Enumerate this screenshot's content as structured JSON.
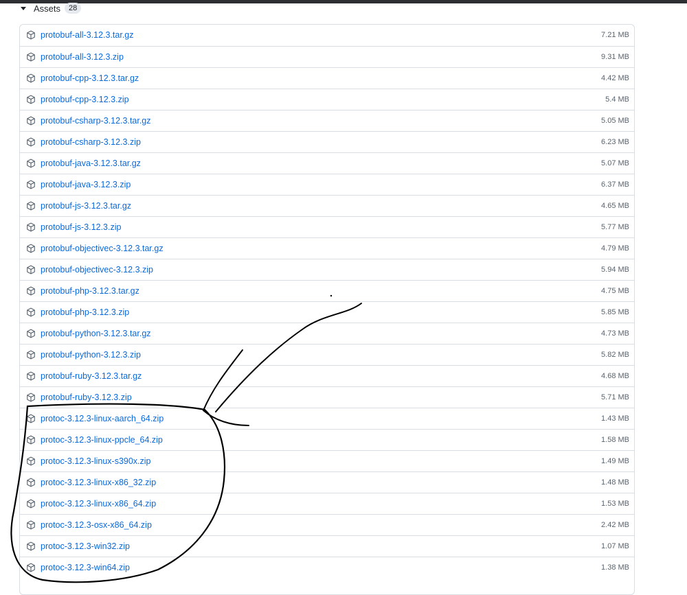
{
  "assets": {
    "title": "Assets",
    "count": "28",
    "items": [
      {
        "name": "protobuf-all-3.12.3.tar.gz",
        "size": "7.21 MB"
      },
      {
        "name": "protobuf-all-3.12.3.zip",
        "size": "9.31 MB"
      },
      {
        "name": "protobuf-cpp-3.12.3.tar.gz",
        "size": "4.42 MB"
      },
      {
        "name": "protobuf-cpp-3.12.3.zip",
        "size": "5.4 MB"
      },
      {
        "name": "protobuf-csharp-3.12.3.tar.gz",
        "size": "5.05 MB"
      },
      {
        "name": "protobuf-csharp-3.12.3.zip",
        "size": "6.23 MB"
      },
      {
        "name": "protobuf-java-3.12.3.tar.gz",
        "size": "5.07 MB"
      },
      {
        "name": "protobuf-java-3.12.3.zip",
        "size": "6.37 MB"
      },
      {
        "name": "protobuf-js-3.12.3.tar.gz",
        "size": "4.65 MB"
      },
      {
        "name": "protobuf-js-3.12.3.zip",
        "size": "5.77 MB"
      },
      {
        "name": "protobuf-objectivec-3.12.3.tar.gz",
        "size": "4.79 MB"
      },
      {
        "name": "protobuf-objectivec-3.12.3.zip",
        "size": "5.94 MB"
      },
      {
        "name": "protobuf-php-3.12.3.tar.gz",
        "size": "4.75 MB"
      },
      {
        "name": "protobuf-php-3.12.3.zip",
        "size": "5.85 MB"
      },
      {
        "name": "protobuf-python-3.12.3.tar.gz",
        "size": "4.73 MB"
      },
      {
        "name": "protobuf-python-3.12.3.zip",
        "size": "5.82 MB"
      },
      {
        "name": "protobuf-ruby-3.12.3.tar.gz",
        "size": "4.68 MB"
      },
      {
        "name": "protobuf-ruby-3.12.3.zip",
        "size": "5.71 MB"
      },
      {
        "name": "protoc-3.12.3-linux-aarch_64.zip",
        "size": "1.43 MB"
      },
      {
        "name": "protoc-3.12.3-linux-ppcle_64.zip",
        "size": "1.58 MB"
      },
      {
        "name": "protoc-3.12.3-linux-s390x.zip",
        "size": "1.49 MB"
      },
      {
        "name": "protoc-3.12.3-linux-x86_32.zip",
        "size": "1.48 MB"
      },
      {
        "name": "protoc-3.12.3-linux-x86_64.zip",
        "size": "1.53 MB"
      },
      {
        "name": "protoc-3.12.3-osx-x86_64.zip",
        "size": "2.42 MB"
      },
      {
        "name": "protoc-3.12.3-win32.zip",
        "size": "1.07 MB"
      },
      {
        "name": "protoc-3.12.3-win64.zip",
        "size": "1.38 MB"
      }
    ]
  },
  "icons": {
    "row_icon": "package-icon",
    "toggle_icon": "triangle-down-icon"
  },
  "colors": {
    "link": "#0969da",
    "size_text": "#59636e",
    "border": "#d8dee4",
    "annotation": "#000000"
  }
}
